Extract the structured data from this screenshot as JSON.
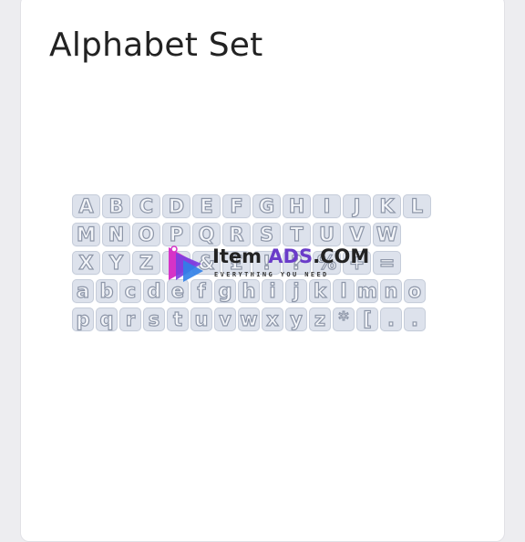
{
  "card": {
    "title": "Alphabet Set"
  },
  "alphabet_set": {
    "rows": [
      [
        "A",
        "B",
        "C",
        "D",
        "E",
        "F",
        "G",
        "H",
        "I",
        "J",
        "K",
        "L"
      ],
      [
        "M",
        "N",
        "O",
        "P",
        "Q",
        "R",
        "S",
        "T",
        "U",
        "V",
        "W"
      ],
      [
        "X",
        "Y",
        "Z",
        "$",
        "&",
        "£",
        "!",
        "?",
        "%",
        "+",
        "="
      ],
      [
        "a",
        "b",
        "c",
        "d",
        "e",
        "f",
        "g",
        "h",
        "i",
        "j",
        "k",
        "l",
        "m",
        "n",
        "o"
      ],
      [
        "p",
        "q",
        "r",
        "s",
        "t",
        "u",
        "v",
        "w",
        "x",
        "y",
        "z",
        "*",
        "[",
        ".",
        "."
      ]
    ]
  },
  "watermark": {
    "brand_item": "Item",
    "brand_ads": "ADS",
    "brand_com": ".COM",
    "tagline": "EVERYTHING YOU NEED",
    "colors": {
      "logo_magenta": "#d633c7",
      "logo_purple": "#7a3fe0",
      "logo_blue": "#2f7fe8",
      "ads_text": "#6a3cc9"
    }
  },
  "colors": {
    "page_background": "#ededf0",
    "card_background": "#ffffff",
    "key_fill": "#dde2ec",
    "key_outline": "#8d96a8"
  }
}
